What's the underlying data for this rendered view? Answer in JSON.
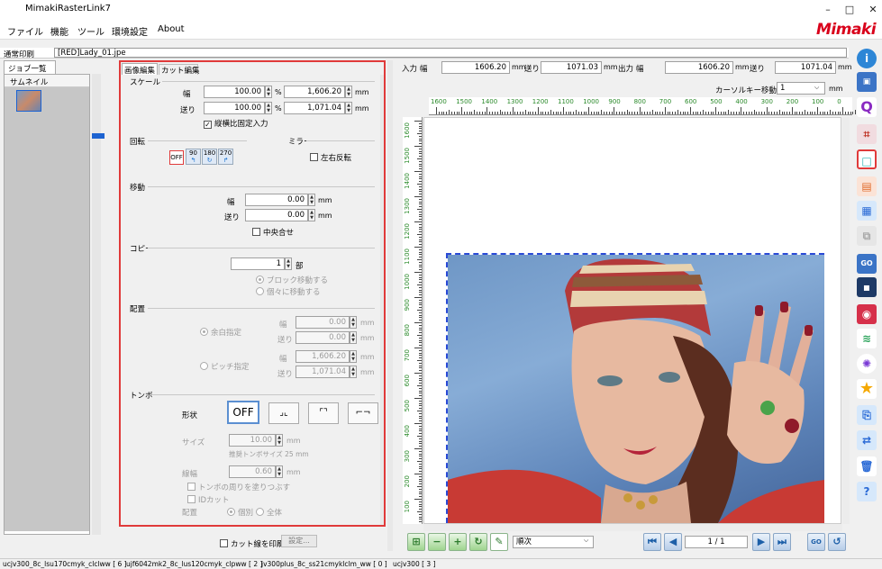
{
  "app": {
    "title": "MimakiRasterLink7",
    "logo": "Mimaki"
  },
  "menu": [
    "ファイル",
    "機能",
    "ツール",
    "環境設定",
    "About"
  ],
  "left": {
    "mode": "通常印刷",
    "file": "[RED]Lady_01.jpe",
    "job_tab": "ジョブ一覧",
    "thumb_header": "サムネイル"
  },
  "tabs": {
    "image_edit": "画像編集",
    "cut_edit": "カット編集"
  },
  "scale": {
    "section": "スケール",
    "width_label": "幅",
    "feed_label": "送り",
    "width_pct": "100.00",
    "feed_pct": "100.00",
    "pct_unit": "%",
    "width_mm": "1,606.20",
    "feed_mm": "1,071.04",
    "mm_unit": "mm",
    "keep_ratio": "縦横比固定入力"
  },
  "rotate": {
    "section": "回転",
    "off": "OFF",
    "r90": "90",
    "r180": "180",
    "r270": "270"
  },
  "mirror": {
    "section": "ミラー",
    "label": "左右反転"
  },
  "move": {
    "section": "移動",
    "width_label": "幅",
    "feed_label": "送り",
    "width": "0.00",
    "feed": "0.00",
    "unit": "mm",
    "center": "中央合せ"
  },
  "copy": {
    "section": "コピー",
    "count": "1",
    "unit": "部",
    "opt1": "ブロック移動する",
    "opt2": "個々に移動する"
  },
  "layout": {
    "section": "配置",
    "margin_label": "余白指定",
    "pitch_label": "ピッチ指定",
    "w_label": "幅",
    "f_label": "送り",
    "margin_w": "0.00",
    "margin_f": "0.00",
    "pitch_w": "1,606.20",
    "pitch_f": "1,071.04",
    "unit": "mm"
  },
  "tombo": {
    "section": "トンボ",
    "shape_label": "形状",
    "off": "OFF",
    "size_label": "サイズ",
    "size": "10.00",
    "rec_size": "推奨トンボサイズ 25 mm",
    "line_label": "線幅",
    "line": "0.60",
    "unit": "mm",
    "fill": "トンボの周りを塗りつぶす",
    "idcut": "IDカット",
    "place_label": "配置",
    "place1": "個別",
    "place2": "全体"
  },
  "cutline": {
    "label": "カット線を印刷",
    "settings": "設定..."
  },
  "top": {
    "in_label": "入力",
    "w_label": "幅",
    "in_w": "1606.20",
    "mm": "mm",
    "f_label": "送り",
    "in_f": "1071.03",
    "out_label": "出力",
    "out_w": "1606.20",
    "out_f": "1071.04",
    "cursor_label": "カーソルキー移動量",
    "cursor_val": "1"
  },
  "ruler_top": [
    "1600",
    "1500",
    "1400",
    "1300",
    "1200",
    "1100",
    "1000",
    "900",
    "800",
    "700",
    "600",
    "500",
    "400",
    "300",
    "200",
    "100",
    "0"
  ],
  "ruler_left": [
    "1600",
    "1500",
    "1400",
    "1300",
    "1200",
    "1100",
    "1000",
    "900",
    "800",
    "700",
    "600",
    "500",
    "400",
    "300",
    "200",
    "100"
  ],
  "bottom": {
    "order": "順次",
    "page": "1 / 1"
  },
  "status": [
    "ucjv300_8c_lsu170cmyk_clclww [ 6 ]",
    "ujf6042mk2_8c_lus120cmyk_clpww [ 2 ]",
    "jv300plus_8c_ss21cmyklclm_ww [ 0 ]",
    "ucjv300 [ 3 ]"
  ],
  "colors": {
    "accent_red": "#d9001b",
    "selection_red": "#e53935",
    "dash_blue": "#2a4ad6"
  }
}
